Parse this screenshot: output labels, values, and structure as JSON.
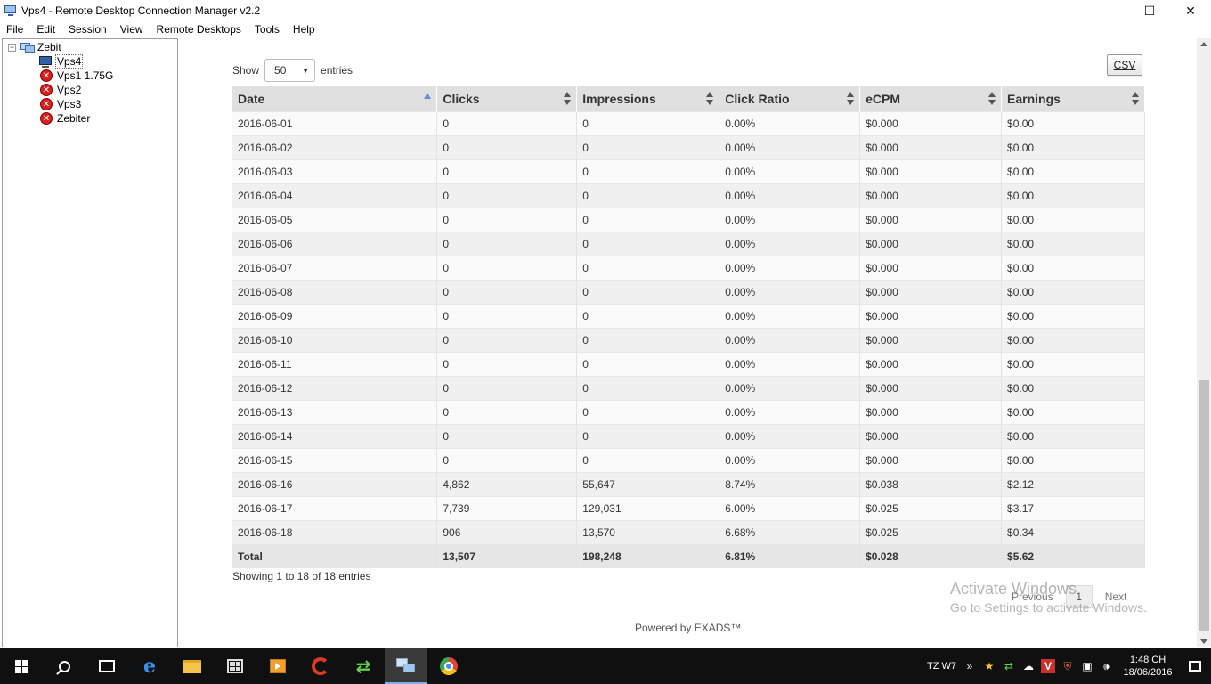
{
  "window": {
    "title": "Vps4 - Remote Desktop Connection Manager v2.2",
    "minimize": "—",
    "maximize": "☐",
    "close": "✕"
  },
  "menu": [
    "File",
    "Edit",
    "Session",
    "View",
    "Remote Desktops",
    "Tools",
    "Help"
  ],
  "tree": {
    "root": "Zebit",
    "expander": "−",
    "items": [
      {
        "label": "Vps4",
        "status": "connected",
        "selected": true
      },
      {
        "label": "Vps1 1.75G",
        "status": "error"
      },
      {
        "label": "Vps2",
        "status": "error"
      },
      {
        "label": "Vps3",
        "status": "error"
      },
      {
        "label": "Zebiter",
        "status": "error"
      }
    ]
  },
  "report": {
    "show_label": "Show",
    "entries_value": "50",
    "entries_label": "entries",
    "csv_label": "CSV",
    "columns": [
      "Date",
      "Clicks",
      "Impressions",
      "Click Ratio",
      "eCPM",
      "Earnings"
    ],
    "rows": [
      [
        "2016-06-01",
        "0",
        "0",
        "0.00%",
        "$0.000",
        "$0.00"
      ],
      [
        "2016-06-02",
        "0",
        "0",
        "0.00%",
        "$0.000",
        "$0.00"
      ],
      [
        "2016-06-03",
        "0",
        "0",
        "0.00%",
        "$0.000",
        "$0.00"
      ],
      [
        "2016-06-04",
        "0",
        "0",
        "0.00%",
        "$0.000",
        "$0.00"
      ],
      [
        "2016-06-05",
        "0",
        "0",
        "0.00%",
        "$0.000",
        "$0.00"
      ],
      [
        "2016-06-06",
        "0",
        "0",
        "0.00%",
        "$0.000",
        "$0.00"
      ],
      [
        "2016-06-07",
        "0",
        "0",
        "0.00%",
        "$0.000",
        "$0.00"
      ],
      [
        "2016-06-08",
        "0",
        "0",
        "0.00%",
        "$0.000",
        "$0.00"
      ],
      [
        "2016-06-09",
        "0",
        "0",
        "0.00%",
        "$0.000",
        "$0.00"
      ],
      [
        "2016-06-10",
        "0",
        "0",
        "0.00%",
        "$0.000",
        "$0.00"
      ],
      [
        "2016-06-11",
        "0",
        "0",
        "0.00%",
        "$0.000",
        "$0.00"
      ],
      [
        "2016-06-12",
        "0",
        "0",
        "0.00%",
        "$0.000",
        "$0.00"
      ],
      [
        "2016-06-13",
        "0",
        "0",
        "0.00%",
        "$0.000",
        "$0.00"
      ],
      [
        "2016-06-14",
        "0",
        "0",
        "0.00%",
        "$0.000",
        "$0.00"
      ],
      [
        "2016-06-15",
        "0",
        "0",
        "0.00%",
        "$0.000",
        "$0.00"
      ],
      [
        "2016-06-16",
        "4,862",
        "55,647",
        "8.74%",
        "$0.038",
        "$2.12"
      ],
      [
        "2016-06-17",
        "7,739",
        "129,031",
        "6.00%",
        "$0.025",
        "$3.17"
      ],
      [
        "2016-06-18",
        "906",
        "13,570",
        "6.68%",
        "$0.025",
        "$0.34"
      ]
    ],
    "total": [
      "Total",
      "13,507",
      "198,248",
      "6.81%",
      "$0.028",
      "$5.62"
    ],
    "info": "Showing 1 to 18 of 18 entries",
    "pager": {
      "previous": "Previous",
      "current": "1",
      "next": "Next"
    },
    "powered_by": "Powered by EXADS™"
  },
  "watermark": {
    "line1": "Activate Windows",
    "line2": "Go to Settings to activate Windows."
  },
  "taskbar": {
    "apps": [
      "start",
      "search",
      "task-view",
      "edge",
      "file-explorer",
      "store",
      "media-player",
      "ccleaner",
      "sync",
      "rdcman",
      "chrome"
    ],
    "active_app": "rdcman",
    "tray_text": "TZ W7",
    "tray_chevron": "»",
    "time": "1:48 CH",
    "date": "18/06/2016"
  }
}
